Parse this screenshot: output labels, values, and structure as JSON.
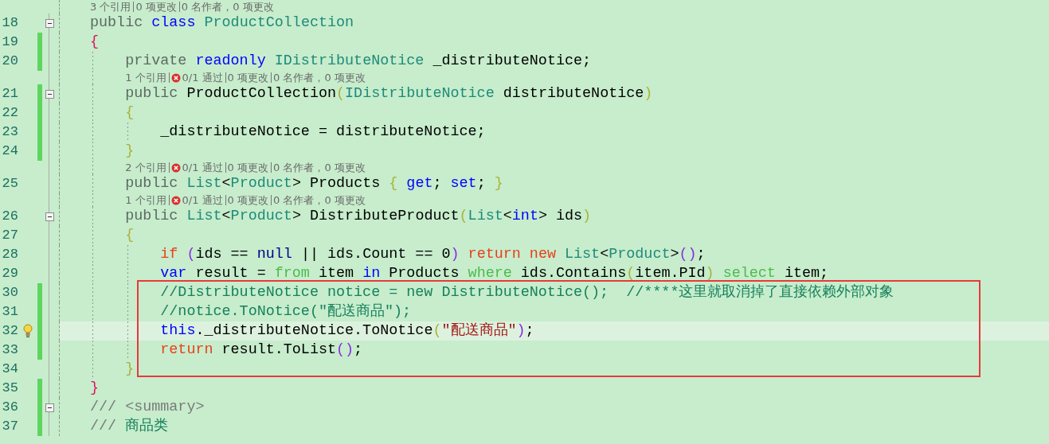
{
  "lines": [
    {
      "kind": "lens",
      "items": [
        {
          "text": "3 个引用"
        },
        {
          "text": "0 项更改"
        },
        {
          "text": "0 名作者，0 项更改"
        }
      ]
    },
    {
      "kind": "code",
      "number": "18",
      "foldable": true,
      "changed": false,
      "tokens": [
        {
          "kind": "modifier",
          "text": "public "
        },
        {
          "kind": "keyword",
          "text": "class "
        },
        {
          "kind": "type",
          "text": "ProductCollection"
        }
      ]
    },
    {
      "kind": "code",
      "number": "19",
      "changed": true,
      "tokens": [
        {
          "kind": "brace1",
          "text": "{"
        }
      ],
      "children": [
        {
          "kind": "code",
          "number": "20",
          "changed": true,
          "tokens": [
            {
              "kind": "modifier",
              "text": "private "
            },
            {
              "kind": "keyword",
              "text": "readonly "
            },
            {
              "kind": "type",
              "text": "IDistributeNotice"
            },
            {
              "kind": "plain",
              "text": " _distributeNotice;"
            }
          ]
        },
        {
          "kind": "lens",
          "items": [
            {
              "text": "1 个引用"
            },
            {
              "text": "0/1 通过",
              "failed": true
            },
            {
              "text": "0 项更改"
            },
            {
              "text": "0 名作者，0 项更改"
            }
          ]
        },
        {
          "kind": "code",
          "number": "21",
          "foldable": true,
          "changed": true,
          "tokens": [
            {
              "kind": "modifier",
              "text": "public "
            },
            {
              "kind": "plain",
              "text": "ProductCollection"
            },
            {
              "kind": "brace2",
              "text": "("
            },
            {
              "kind": "type",
              "text": "IDistributeNotice"
            },
            {
              "kind": "plain",
              "text": " distributeNotice"
            },
            {
              "kind": "brace2",
              "text": ")"
            }
          ]
        },
        {
          "kind": "code",
          "number": "22",
          "changed": true,
          "tokens": [
            {
              "kind": "brace2",
              "text": "{"
            }
          ],
          "children": [
            {
              "kind": "code",
              "number": "23",
              "changed": true,
              "tokens": [
                {
                  "kind": "plain",
                  "text": "_distributeNotice = distributeNotice;"
                }
              ]
            }
          ]
        },
        {
          "kind": "code",
          "number": "24",
          "changed": true,
          "tokens": [
            {
              "kind": "brace2",
              "text": "}"
            }
          ]
        },
        {
          "kind": "lens",
          "items": [
            {
              "text": "2 个引用"
            },
            {
              "text": "0/1 通过",
              "failed": true
            },
            {
              "text": "0 项更改"
            },
            {
              "text": "0 名作者，0 项更改"
            }
          ]
        },
        {
          "kind": "code",
          "number": "25",
          "changed": false,
          "tokens": [
            {
              "kind": "modifier",
              "text": "public "
            },
            {
              "kind": "type",
              "text": "List"
            },
            {
              "kind": "plain",
              "text": "<"
            },
            {
              "kind": "type",
              "text": "Product"
            },
            {
              "kind": "plain",
              "text": "> Products "
            },
            {
              "kind": "brace2",
              "text": "{ "
            },
            {
              "kind": "keyword",
              "text": "get"
            },
            {
              "kind": "plain",
              "text": "; "
            },
            {
              "kind": "keyword",
              "text": "set"
            },
            {
              "kind": "plain",
              "text": "; "
            },
            {
              "kind": "brace2",
              "text": "}"
            }
          ]
        },
        {
          "kind": "lens",
          "items": [
            {
              "text": "1 个引用"
            },
            {
              "text": "0/1 通过",
              "failed": true
            },
            {
              "text": "0 项更改"
            },
            {
              "text": "0 名作者，0 项更改"
            }
          ]
        },
        {
          "kind": "code",
          "number": "26",
          "foldable": true,
          "changed": false,
          "tokens": [
            {
              "kind": "modifier",
              "text": "public "
            },
            {
              "kind": "type",
              "text": "List"
            },
            {
              "kind": "plain",
              "text": "<"
            },
            {
              "kind": "type",
              "text": "Product"
            },
            {
              "kind": "plain",
              "text": "> DistributeProduct"
            },
            {
              "kind": "brace2",
              "text": "("
            },
            {
              "kind": "type",
              "text": "List"
            },
            {
              "kind": "plain",
              "text": "<"
            },
            {
              "kind": "keyword",
              "text": "int"
            },
            {
              "kind": "plain",
              "text": "> ids"
            },
            {
              "kind": "brace2",
              "text": ")"
            }
          ]
        },
        {
          "kind": "code",
          "number": "27",
          "changed": false,
          "tokens": [
            {
              "kind": "brace2",
              "text": "{"
            }
          ],
          "children": [
            {
              "kind": "code",
              "number": "28",
              "changed": false,
              "tokens": [
                {
                  "kind": "control",
                  "text": "if "
                },
                {
                  "kind": "brace3",
                  "text": "("
                },
                {
                  "kind": "plain",
                  "text": "ids == "
                },
                {
                  "kind": "literal",
                  "text": "null"
                },
                {
                  "kind": "plain",
                  "text": " || ids.Count == 0"
                },
                {
                  "kind": "brace3",
                  "text": ")"
                },
                {
                  "kind": "control",
                  "text": " return new "
                },
                {
                  "kind": "type",
                  "text": "List"
                },
                {
                  "kind": "plain",
                  "text": "<"
                },
                {
                  "kind": "type",
                  "text": "Product"
                },
                {
                  "kind": "plain",
                  "text": ">"
                },
                {
                  "kind": "brace3",
                  "text": "()"
                },
                {
                  "kind": "plain",
                  "text": ";"
                }
              ]
            },
            {
              "kind": "code",
              "number": "29",
              "changed": false,
              "tokens": [
                {
                  "kind": "keyword",
                  "text": "var"
                },
                {
                  "kind": "plain",
                  "text": " result = "
                },
                {
                  "kind": "linq",
                  "text": "from"
                },
                {
                  "kind": "plain",
                  "text": " item "
                },
                {
                  "kind": "keyword",
                  "text": "in"
                },
                {
                  "kind": "plain",
                  "text": " Products "
                },
                {
                  "kind": "linq",
                  "text": "where"
                },
                {
                  "kind": "plain",
                  "text": " ids.Contains"
                },
                {
                  "kind": "brace2",
                  "text": "("
                },
                {
                  "kind": "plain",
                  "text": "item.PId"
                },
                {
                  "kind": "brace2",
                  "text": ")"
                },
                {
                  "kind": "linq",
                  "text": " select"
                },
                {
                  "kind": "plain",
                  "text": " item;"
                }
              ]
            },
            {
              "kind": "code",
              "number": "30",
              "changed": true,
              "boxed": true,
              "tokens": [
                {
                  "kind": "comment",
                  "text": "//DistributeNotice notice = new DistributeNotice();  //****这里就取消掉了直接依赖外部对象"
                }
              ]
            },
            {
              "kind": "code",
              "number": "31",
              "changed": true,
              "boxed": true,
              "tokens": [
                {
                  "kind": "comment",
                  "text": "//notice.ToNotice(\"配送商品\");"
                }
              ]
            },
            {
              "kind": "code",
              "number": "32",
              "changed": true,
              "boxed": true,
              "current": true,
              "lightbulb": true,
              "tokens": [
                {
                  "kind": "keyword",
                  "text": "this"
                },
                {
                  "kind": "plain",
                  "text": "._distributeNotice.ToNotice"
                },
                {
                  "kind": "brace2",
                  "text": "("
                },
                {
                  "kind": "string",
                  "text": "\"配送商品\""
                },
                {
                  "kind": "brace3",
                  "text": ")"
                },
                {
                  "kind": "plain",
                  "text": ";"
                }
              ]
            },
            {
              "kind": "code",
              "number": "33",
              "changed": true,
              "boxed": true,
              "tokens": [
                {
                  "kind": "control",
                  "text": "return"
                },
                {
                  "kind": "plain",
                  "text": " result.ToList"
                },
                {
                  "kind": "brace3",
                  "text": "()"
                },
                {
                  "kind": "plain",
                  "text": ";"
                }
              ]
            }
          ]
        },
        {
          "kind": "code",
          "number": "34",
          "changed": false,
          "boxed": true,
          "tokens": [
            {
              "kind": "brace2",
              "text": "}"
            }
          ]
        }
      ]
    },
    {
      "kind": "code",
      "number": "35",
      "changed": true,
      "tokens": [
        {
          "kind": "brace1",
          "text": "}"
        }
      ]
    },
    {
      "kind": "code",
      "number": "36",
      "foldable": true,
      "changed": true,
      "tokens": [
        {
          "kind": "doc",
          "text": "/// <summary>"
        }
      ]
    },
    {
      "kind": "code",
      "number": "37",
      "changed": true,
      "tokens": [
        {
          "kind": "doc",
          "text": "/// "
        },
        {
          "kind": "comment",
          "text": "商品类"
        }
      ]
    }
  ]
}
